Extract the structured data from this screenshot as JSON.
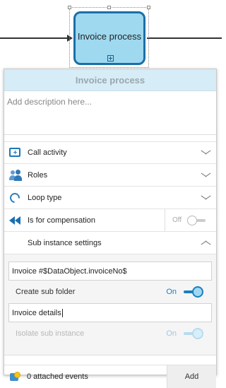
{
  "diagram": {
    "task_label": "Invoice process"
  },
  "panel": {
    "title": "Invoice process",
    "description_placeholder": "Add description here...",
    "sections": {
      "call_activity": "Call activity",
      "roles": "Roles",
      "loop_type": "Loop type",
      "compensation": "Is for compensation",
      "compensation_state": "Off",
      "sub_instance_settings": "Sub instance settings"
    },
    "sub_instance": {
      "name_value": "Invoice #$DataObject.invoiceNo$",
      "create_sub_folder_label": "Create sub folder",
      "create_sub_folder_state": "On",
      "folder_name_value": "Invoice details",
      "isolate_label": "Isolate sub instance",
      "isolate_state": "On"
    },
    "footer": {
      "events_label": "0 attached events",
      "add_label": "Add"
    }
  },
  "colors": {
    "task_fill": "#9ed9f0",
    "task_border": "#1a6fa6",
    "header_bg": "#d6ecf7",
    "accent": "#1a7fc2"
  },
  "icons": {
    "call_activity": "call-activity-icon",
    "roles": "roles-icon",
    "loop_type": "loop-icon",
    "compensation": "compensation-icon",
    "events": "attached-events-icon"
  }
}
